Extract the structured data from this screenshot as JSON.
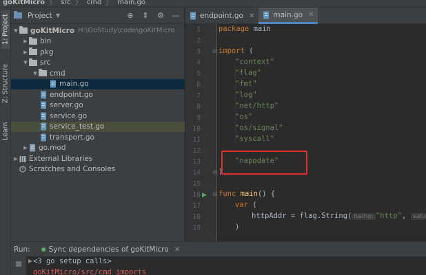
{
  "breadcrumb": [
    "goKitMicro",
    "src",
    "cmd",
    "main.go"
  ],
  "left_strip": {
    "project_tab": "1: Project",
    "structure_tab": "Z: Structure",
    "learn_tab": "Learn"
  },
  "project_panel": {
    "title": "Project",
    "tree": [
      {
        "name": "goKitMicro",
        "path": "H:\\GoStudy\\code\\goKitMicro"
      },
      {
        "name": "bin"
      },
      {
        "name": "pkg"
      },
      {
        "name": "src"
      },
      {
        "name": "cmd"
      },
      {
        "name": "main.go"
      },
      {
        "name": "endpoint.go"
      },
      {
        "name": "server.go"
      },
      {
        "name": "service.go"
      },
      {
        "name": "service_test.go"
      },
      {
        "name": "transport.go"
      },
      {
        "name": "go.mod"
      },
      {
        "name": "External Libraries"
      },
      {
        "name": "Scratches and Consoles"
      }
    ]
  },
  "editor_tabs": [
    {
      "label": "endpoint.go"
    },
    {
      "label": "main.go"
    }
  ],
  "editor": {
    "line_numbers": [
      "1",
      "2",
      "3",
      "4",
      "5",
      "6",
      "7",
      "8",
      "9",
      "10",
      "11",
      "12",
      "13",
      "14",
      "15",
      "16",
      "17",
      "18",
      "19"
    ],
    "code": {
      "l1_kw": "package",
      "l1_name": " main",
      "l3_kw": "import",
      "l3_rest": " (",
      "l4": "\"context\"",
      "l5": "\"flag\"",
      "l6": "\"fmt\"",
      "l7": "\"log\"",
      "l8": "\"net/http\"",
      "l9": "\"os\"",
      "l10": "\"os/signal\"",
      "l11": "\"syscall\"",
      "l13": "\"napodate\"",
      "l14": ")",
      "l16_kw": "func",
      "l16_fn": " main",
      "l16_rest": "() {",
      "l17_kw": "var",
      "l17_rest": " (",
      "l18_var": "httpAddr = flag.String(",
      "l18_hint1": "name:",
      "l18_str": "\"http\"",
      "l18_comma": ",",
      "l18_hint2": "valu",
      "l19": ")"
    }
  },
  "run_panel": {
    "label": "Run:",
    "tab": "Sync dependencies of goKitMicro",
    "console_line1": "<3 go setup calls>",
    "console_line2": "goKitMicro/src/cmd imports"
  }
}
